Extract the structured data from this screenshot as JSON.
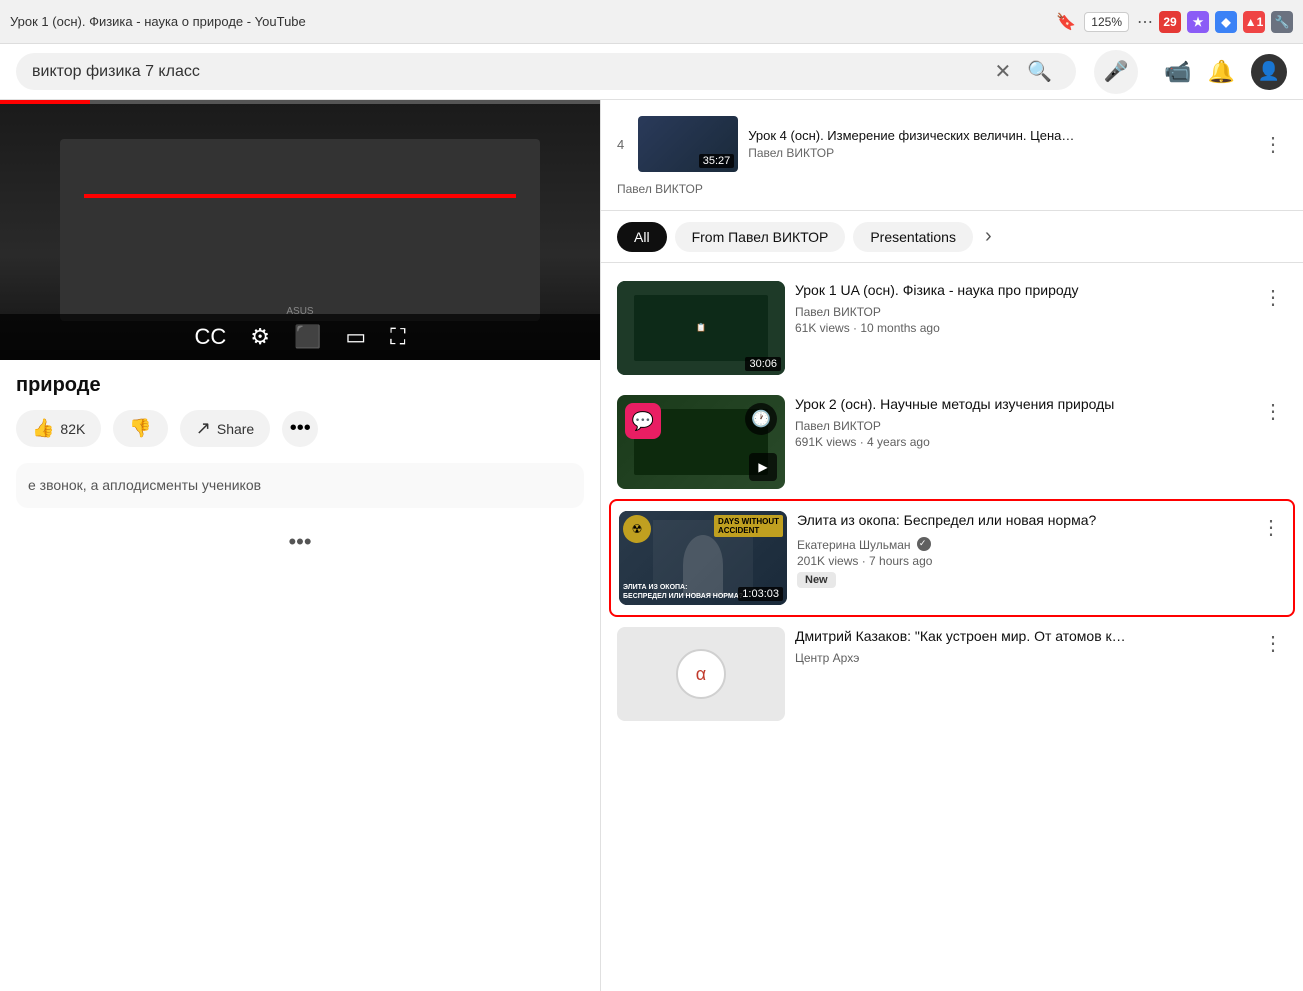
{
  "browser": {
    "title": "Урок 1 (осн). Физика - наука о природе - YouTube",
    "zoom": "125%",
    "bookmark_icon": "🔖",
    "more_icon": "⋯"
  },
  "search": {
    "query": "виктор физика 7 класс",
    "placeholder": "виктор физика 7 класс",
    "clear_icon": "✕",
    "search_icon": "🔍",
    "mic_icon": "🎤",
    "add_video_icon": "📹",
    "bell_icon": "🔔",
    "avatar_icon": "👤"
  },
  "video_player": {
    "title": "природе",
    "likes": "82K",
    "share_label": "Share",
    "more_icon": "•••"
  },
  "description": {
    "text": "е звонок, а аплодисменты учеников"
  },
  "playlist_preview": {
    "number": "4",
    "title": "Урок 4 (осн). Измерение физических величин. Цена…",
    "channel": "Павел ВИКТОР",
    "duration": "35:27",
    "channel_prev": "Павел ВИКТОР"
  },
  "filters": {
    "all_label": "All",
    "from_channel_label": "From Павел ВИКТОР",
    "presentations_label": "Presentations",
    "next_icon": "›"
  },
  "videos": [
    {
      "id": 1,
      "title": "Урок 1 UA (осн). Фізика - наука про природу",
      "channel": "Павел ВИКТОР",
      "views": "61K views",
      "age": "10 months ago",
      "duration": "30:06",
      "thumb_color": "thumb-classroom",
      "highlighted": false
    },
    {
      "id": 2,
      "title": "Урок 2 (осн). Научные методы изучения природы",
      "channel": "Павел ВИКТОР",
      "views": "691K views",
      "age": "4 years ago",
      "duration": "",
      "thumb_color": "thumb-green",
      "highlighted": false,
      "has_quote_overlay": true,
      "has_history_overlay": true
    },
    {
      "id": 3,
      "title": "Элита из окопа: Беспредел или новая норма?",
      "channel": "Екатерина Шульман",
      "channel_verified": true,
      "views": "201K views",
      "age": "7 hours ago",
      "duration": "1:03:03",
      "thumb_color": "thumb-featured",
      "highlighted": true,
      "badge": "New",
      "thumb_text": "ЭЛИТА ИЗ ОКОПА: БЕСПРЕДЕЛ ИЛИ НОВАЯ НОРМА?"
    },
    {
      "id": 4,
      "title": "Дмитрий Казаков: \"Как устроен мир. От атомов к…",
      "channel": "Центр Архэ",
      "views": "",
      "age": "",
      "duration": "",
      "thumb_color": "thumb-archee",
      "highlighted": false
    }
  ]
}
